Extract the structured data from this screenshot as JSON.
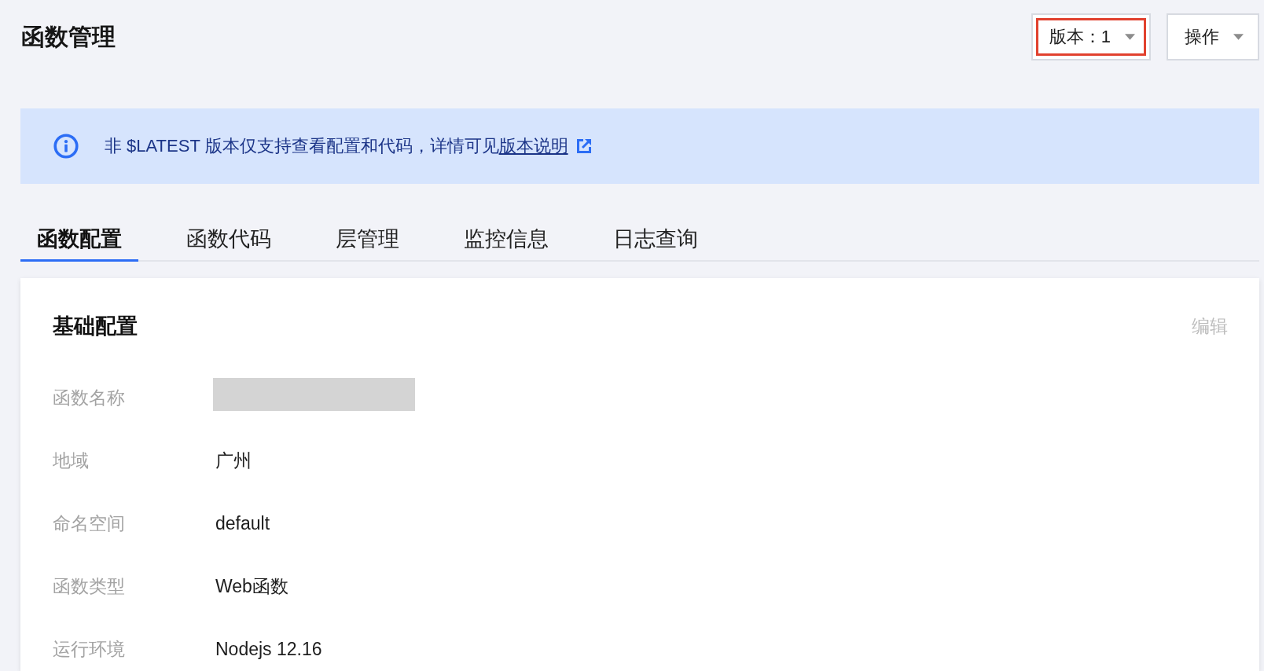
{
  "page": {
    "title": "函数管理"
  },
  "header_buttons": [
    {
      "label": "版本：1",
      "highlighted": true
    },
    {
      "label": "操作",
      "highlighted": false
    }
  ],
  "notice": {
    "text": "非 $LATEST 版本仅支持查看配置和代码，详情可见",
    "link": "版本说明"
  },
  "tabs": [
    {
      "label": "函数配置",
      "selected": true
    },
    {
      "label": "函数代码",
      "selected": false
    },
    {
      "label": "层管理",
      "selected": false
    },
    {
      "label": "监控信息",
      "selected": false
    },
    {
      "label": "日志查询",
      "selected": false
    }
  ],
  "card": {
    "title": "基础配置",
    "edit": {
      "label": "编辑",
      "disabled": true
    },
    "rows": [
      {
        "label": "函数名称",
        "kind": "redacted"
      },
      {
        "label": "地域",
        "kind": "text",
        "value": "广州"
      },
      {
        "label": "命名空间",
        "kind": "text",
        "value": "default"
      },
      {
        "label": "函数类型",
        "kind": "text",
        "value": "Web函数"
      },
      {
        "label": "运行环境",
        "kind": "text",
        "value": "Nodejs 12.16"
      }
    ]
  }
}
